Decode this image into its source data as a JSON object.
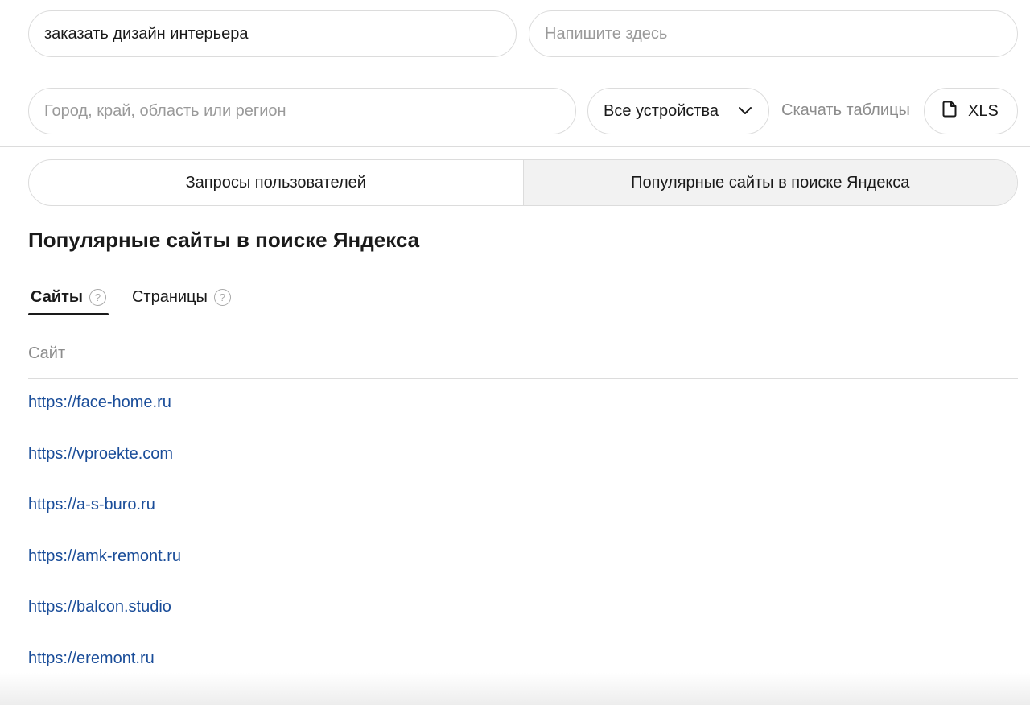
{
  "inputs": {
    "query_value": "заказать дизайн интерьера",
    "extra_placeholder": "Напишите здесь",
    "region_placeholder": "Город, край, область или регион"
  },
  "device_select": {
    "value": "Все устройства"
  },
  "download": {
    "label": "Скачать таблицы",
    "xls_label": "XLS"
  },
  "mode_tabs": [
    {
      "label": "Запросы пользователей",
      "active": false
    },
    {
      "label": "Популярные сайты в поиске Яндекса",
      "active": true
    }
  ],
  "section": {
    "title": "Популярные сайты в поиске Яндекса"
  },
  "subtabs": [
    {
      "label": "Сайты",
      "active": true
    },
    {
      "label": "Страницы",
      "active": false
    }
  ],
  "table": {
    "column_header": "Сайт",
    "rows": [
      "https://face-home.ru",
      "https://vproekte.com",
      "https://a-s-buro.ru",
      "https://amk-remont.ru",
      "https://balcon.studio",
      "https://eremont.ru"
    ]
  },
  "colors": {
    "link": "#1a4d99",
    "border": "#dcdcdc",
    "muted": "#8c8c8c",
    "active_tab_bg": "#f2f2f2"
  }
}
